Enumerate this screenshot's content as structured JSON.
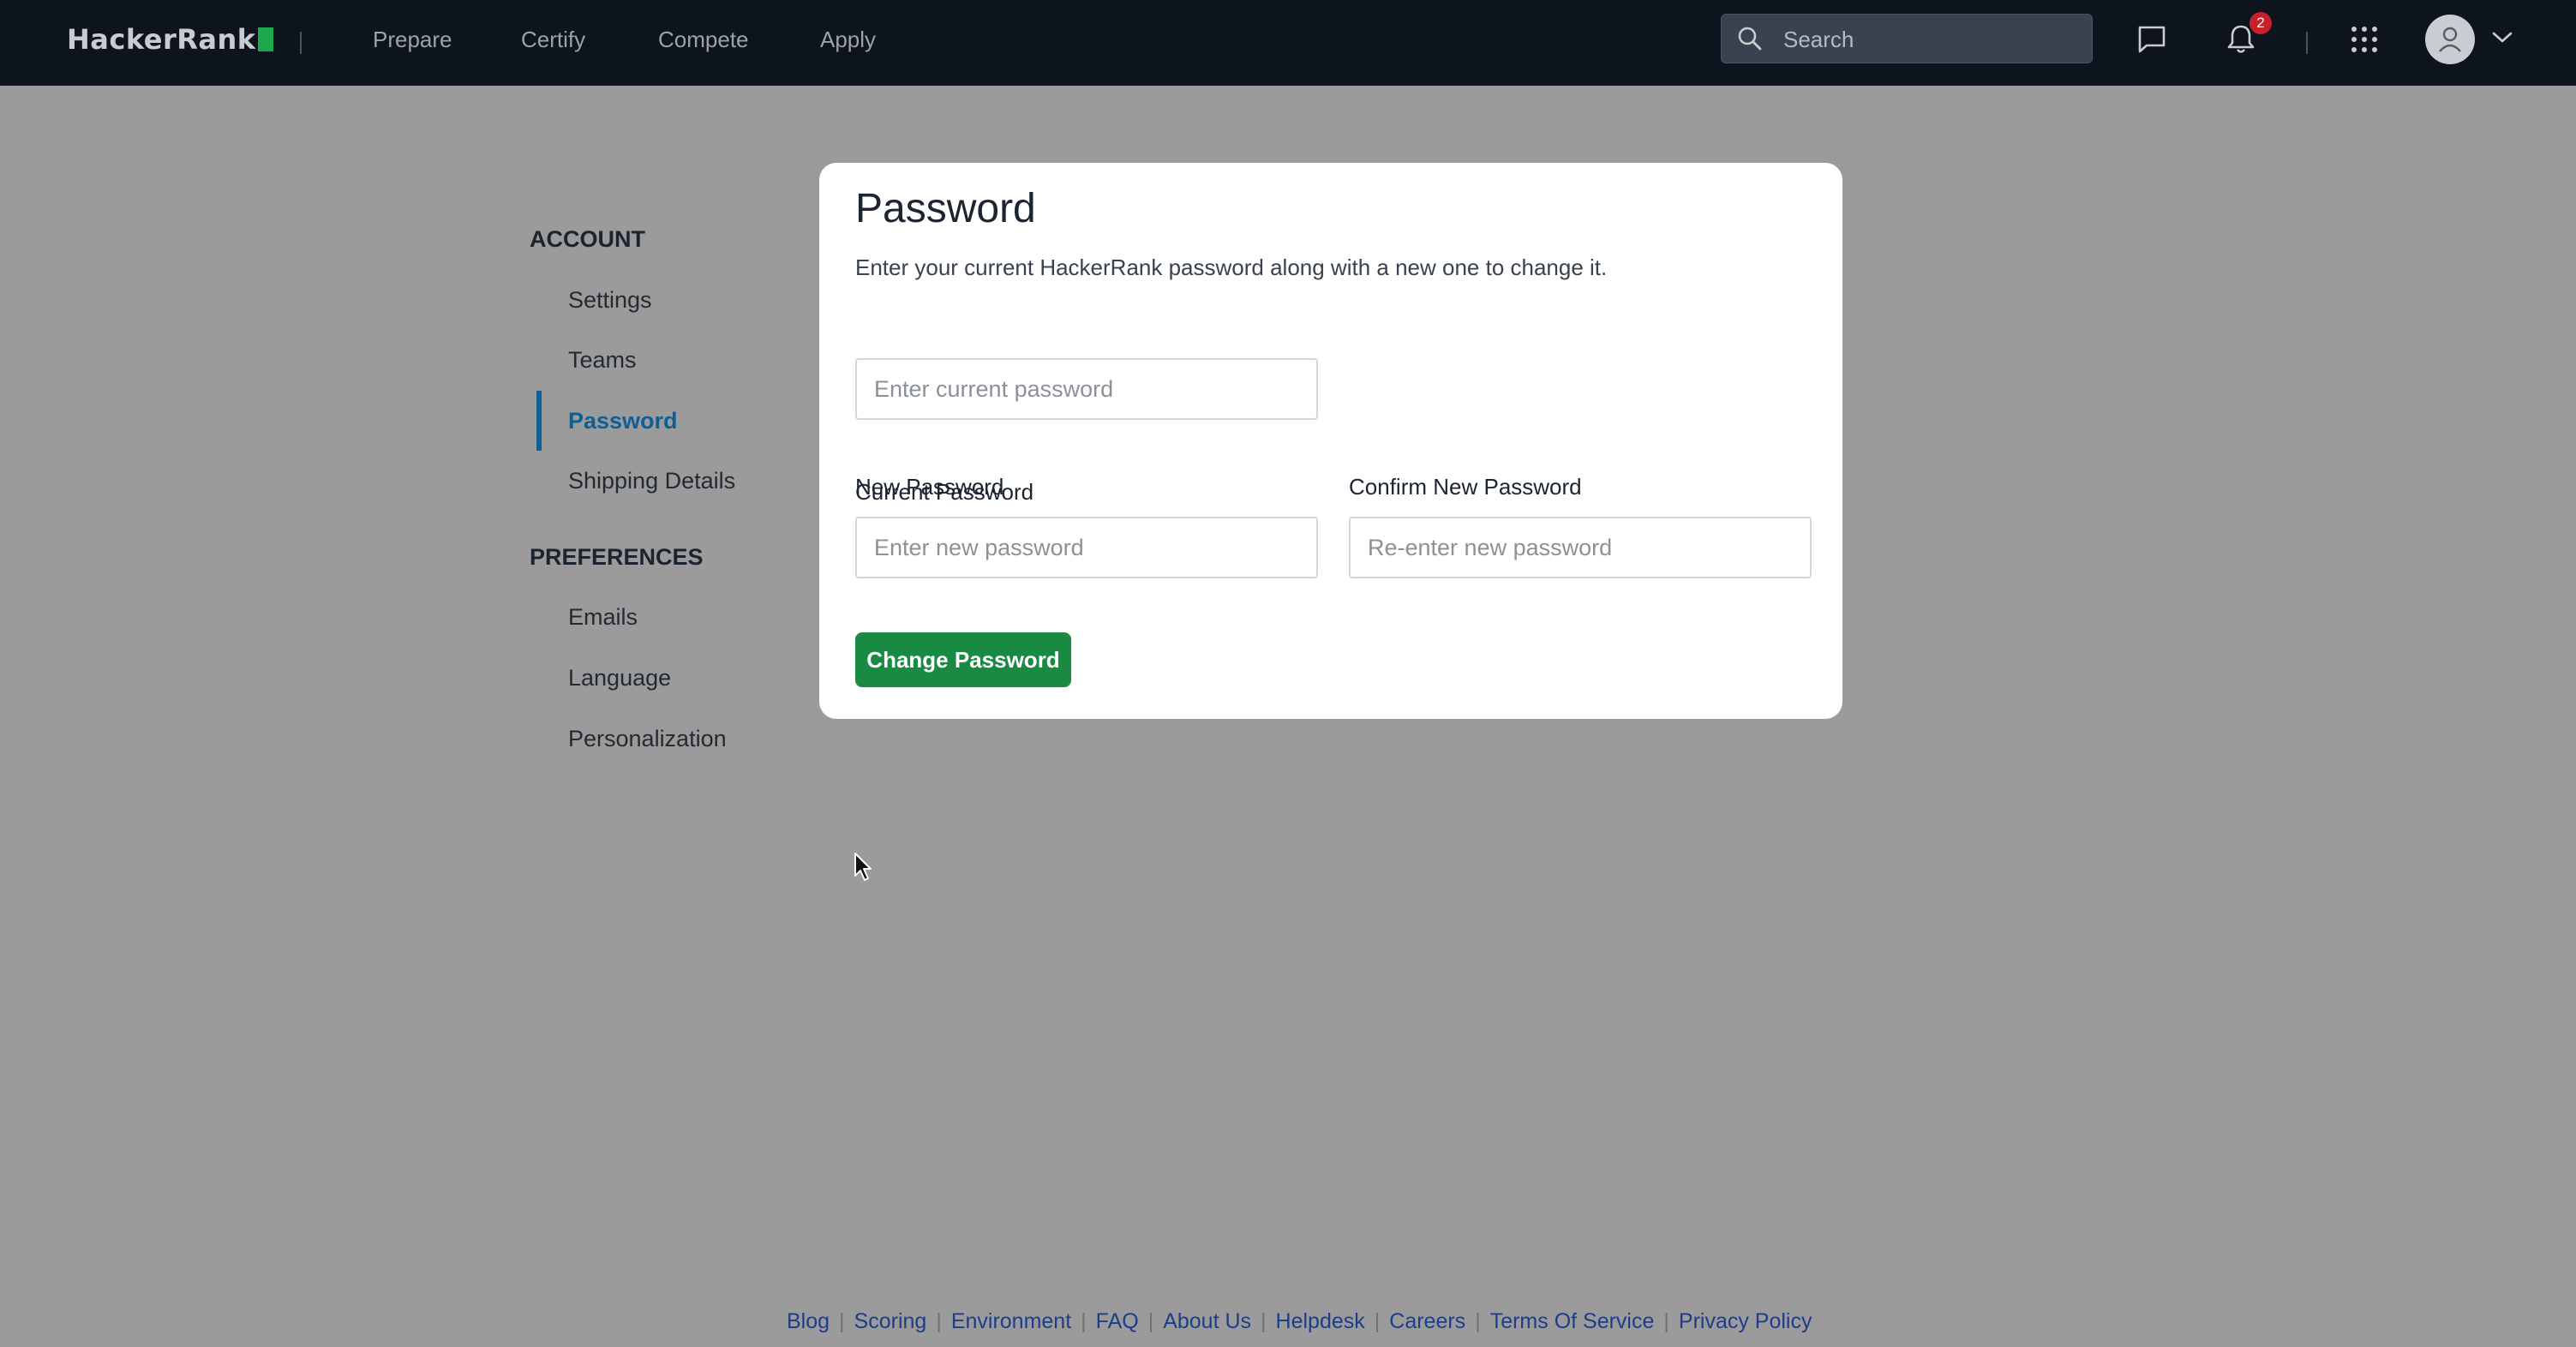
{
  "colors": {
    "nav_bg": "#0e141e",
    "overlay_bg": "#9b9b9b",
    "brand_green": "#1ba94c",
    "button_green": "#188a42",
    "active_blue": "#0d5f96",
    "link_blue": "#1c3d8c",
    "badge_red": "#c8202a"
  },
  "header": {
    "logo": "HackerRank",
    "nav": [
      "Prepare",
      "Certify",
      "Compete",
      "Apply"
    ],
    "search_placeholder": "Search",
    "notification_count": "2",
    "icons": [
      "search-icon",
      "chat-icon",
      "bell-icon",
      "apps-grid-icon",
      "user-icon",
      "chevron-down-icon"
    ]
  },
  "sidebar": {
    "account_heading": "ACCOUNT",
    "account_items": [
      "Settings",
      "Teams",
      "Password",
      "Shipping Details"
    ],
    "active_item": "Password",
    "preferences_heading": "PREFERENCES",
    "preferences_items": [
      "Emails",
      "Language",
      "Personalization"
    ]
  },
  "password_form": {
    "title": "Password",
    "description": "Enter your current HackerRank password along with a new one to change it.",
    "current_label": "Current Password",
    "current_placeholder": "Enter current password",
    "new_label": "New Password",
    "new_placeholder": "Enter new password",
    "confirm_label": "Confirm New Password",
    "confirm_placeholder": "Re-enter new password",
    "submit_label": "Change Password"
  },
  "footer": {
    "links": [
      "Blog",
      "Scoring",
      "Environment",
      "FAQ",
      "About Us",
      "Helpdesk",
      "Careers",
      "Terms Of Service",
      "Privacy Policy"
    ]
  }
}
